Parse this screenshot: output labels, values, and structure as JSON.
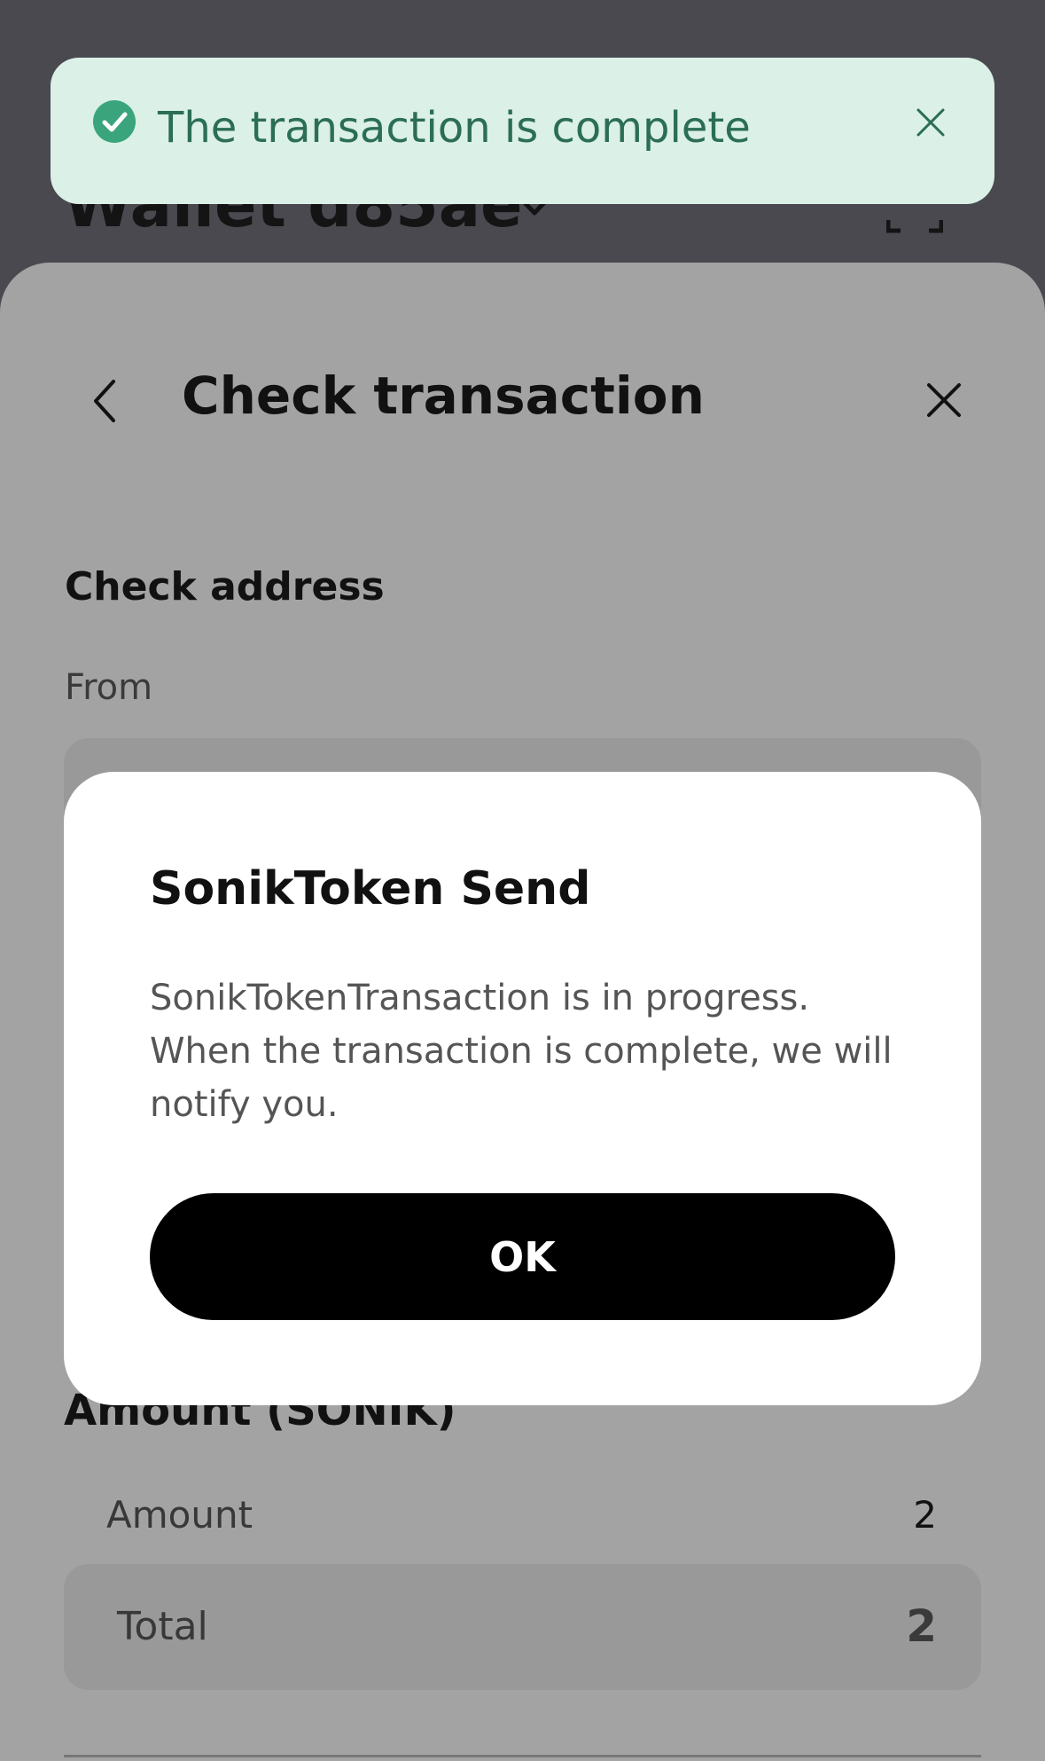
{
  "toast": {
    "message": "The transaction is complete",
    "check_icon": "check-circle-icon",
    "close_icon": "close-icon",
    "accent_color": "#3aa57c",
    "background_color": "#dbf0e6",
    "text_color": "#2b6e55"
  },
  "app_header": {
    "wallet_name": "Wallet d85ae",
    "chevron_icon": "chevron-down-icon",
    "scan_icon": "scan-icon"
  },
  "sheet": {
    "title": "Check transaction",
    "back_icon": "chevron-left-icon",
    "close_icon": "close-icon",
    "check_address_heading": "Check address",
    "from_label": "From",
    "amount_heading": "Amount (SONIK)",
    "amount_label": "Amount",
    "amount_value": "2",
    "total_label": "Total",
    "total_value": "2"
  },
  "modal": {
    "title": "SonikToken Send",
    "body": "SonikTokenTransaction is in progress. When the transaction is complete, we will notify you.",
    "ok_label": "OK"
  }
}
